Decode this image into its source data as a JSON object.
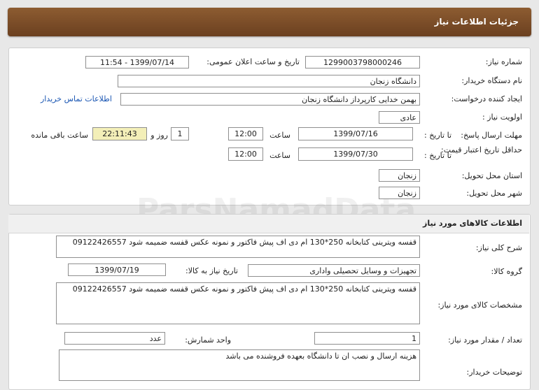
{
  "header": {
    "title": "جزئیات اطلاعات نیاز"
  },
  "watermark": {
    "text": "ParsNamadData"
  },
  "need_info": {
    "need_number_label": "شماره نیاز:",
    "need_number": "1299003798000246",
    "announce_label": "تاریخ و ساعت اعلان عمومی:",
    "announce_value": "1399/07/14 - 11:54",
    "buyer_org_label": "نام دستگاه خریدار:",
    "buyer_org": "دانشگاه زنجان",
    "requester_label": "ایجاد کننده درخواست:",
    "requester": "بهمن خدایی کارپرداز دانشگاه زنجان",
    "contact_link": "اطلاعات تماس خریدار",
    "priority_label": "اولویت نیاز :",
    "priority": "عادی",
    "deadline_label": "مهلت ارسال پاسخ:",
    "until_date_label": "تا تاریخ :",
    "deadline_date": "1399/07/16",
    "time_label": "ساعت",
    "deadline_time": "12:00",
    "days_value": "1",
    "days_label": "روز و",
    "remaining_value": "22:11:43",
    "remaining_label": "ساعت باقی مانده",
    "min_validity_label": "حداقل تاریخ اعتبار قیمت:",
    "validity_date": "1399/07/30",
    "validity_time": "12:00",
    "province_label": "استان محل تحویل:",
    "province": "زنجان",
    "city_label": "شهر محل تحویل:",
    "city": "زنجان"
  },
  "goods": {
    "section_title": "اطلاعات کالاهای مورد نیاز",
    "summary_label": "شرح کلی نیاز:",
    "summary": "قفسه ویترینی کتابخانه 250*130 ام دی اف پیش فاکتور و نمونه عکس قفسه ضمیمه شود 09122426557",
    "group_label": "گروه کالا:",
    "group": "تجهیزات و وسایل تحصیلی واداری",
    "need_date_label": "تاریخ نیاز به کالا:",
    "need_date": "1399/07/19",
    "specs_label": "مشخصات کالای مورد نیاز:",
    "specs": "قفسه ویترینی کتابخانه 250*130 ام دی اف پیش فاکتور و نمونه عکس قفسه ضمیمه شود 09122426557",
    "qty_label": "تعداد / مقدار مورد نیاز:",
    "qty": "1",
    "unit_label": "واحد شمارش:",
    "unit": "عدد",
    "buyer_notes_label": "توضیحات خریدار:",
    "buyer_notes": "هزینه ارسال و نصب ان تا دانشگاه بعهده فروشنده می باشد"
  }
}
